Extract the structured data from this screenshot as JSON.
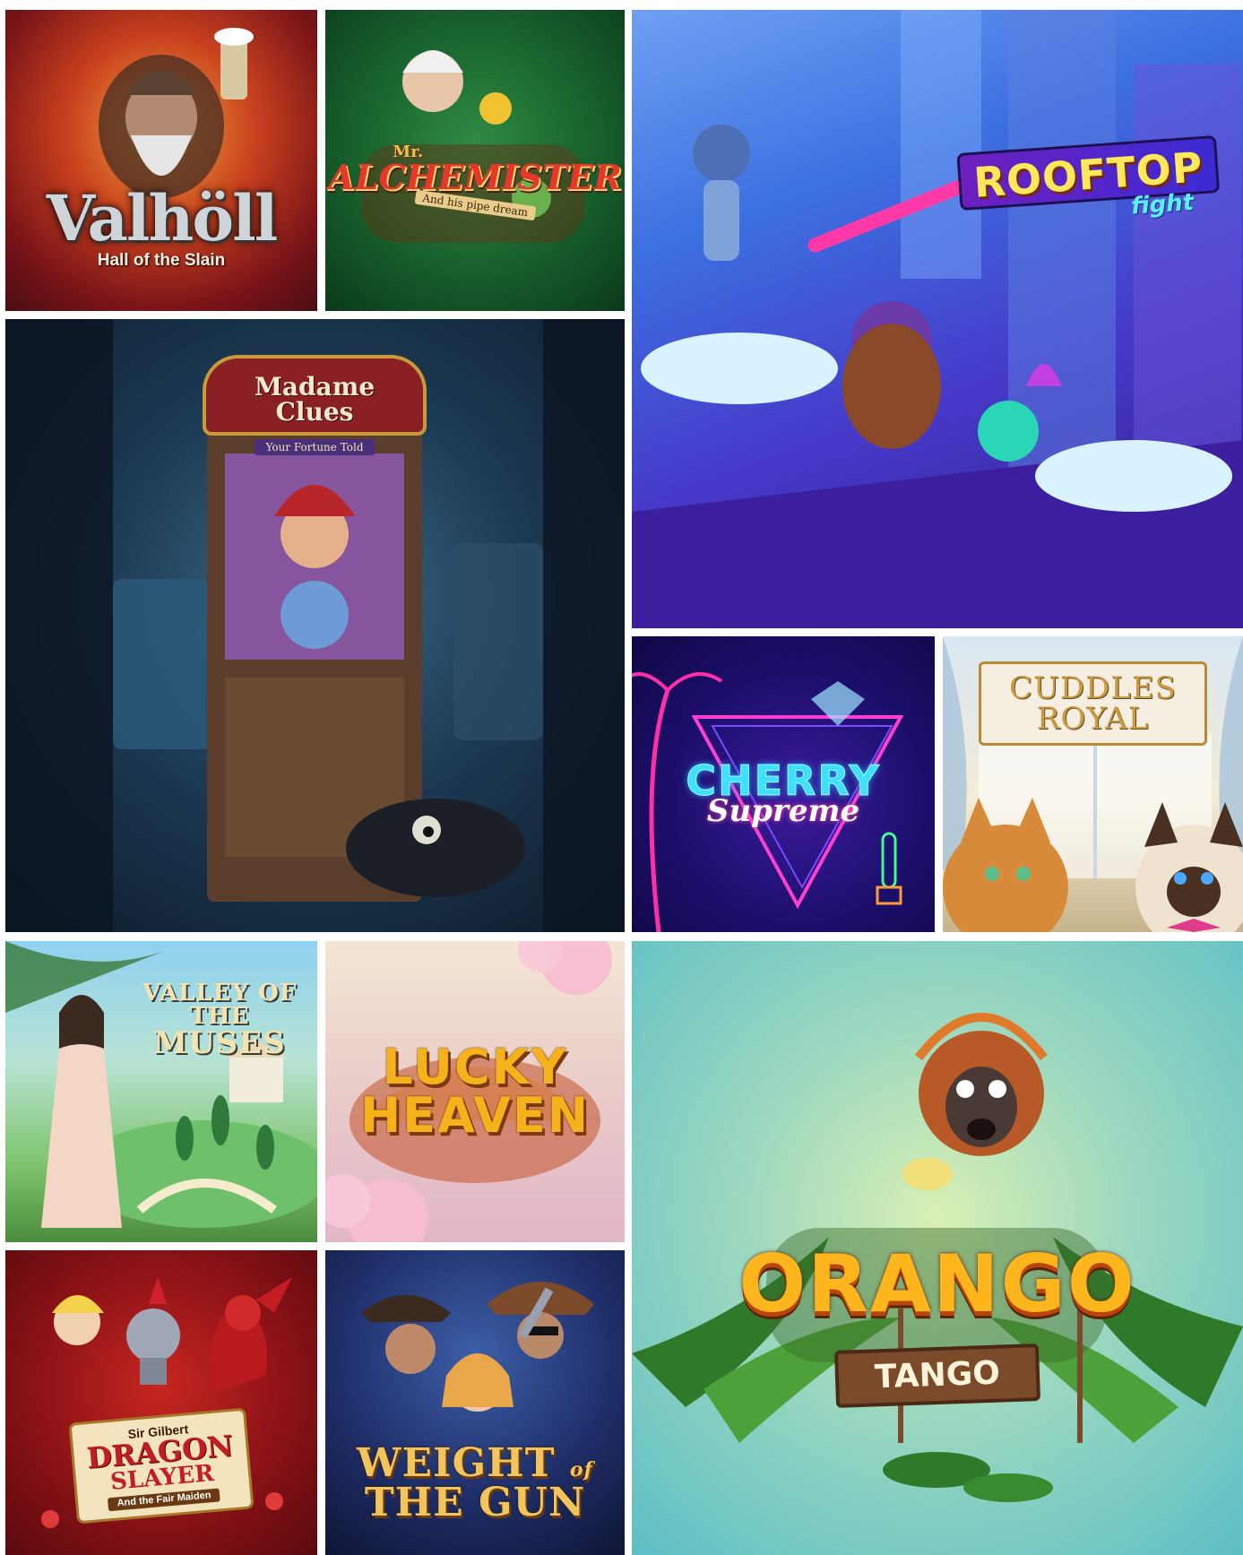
{
  "games": {
    "valholl": {
      "title": "Valhöll",
      "subtitle": "Hall of the Slain"
    },
    "alchemister": {
      "prefix": "Mr.",
      "title": "ALCHEMISTER",
      "subtitle": "And his pipe dream"
    },
    "rooftop": {
      "title": "ROOFTOP",
      "subtitle": "fight"
    },
    "madame": {
      "title": "Madame Clues",
      "subtitle": "Your Fortune Told"
    },
    "cherry": {
      "title": "CHERRY",
      "subtitle": "Supreme"
    },
    "cuddles": {
      "line1": "CUDDLES",
      "line2": "ROYAL"
    },
    "valley": {
      "line1": "VALLEY OF THE",
      "line2": "MUSES"
    },
    "lucky": {
      "line1": "LUCKY",
      "line2": "HEAVEN"
    },
    "orango": {
      "title": "ORANGO",
      "subtitle": "TANGO"
    },
    "dragon": {
      "prefix": "Sir Gilbert",
      "line1": "DRAGON",
      "line2": "SLAYER",
      "subtitle": "And the Fair Maiden"
    },
    "weight": {
      "line1": "WEIGHT",
      "line1_small": "of",
      "line2": "THE GUN"
    }
  }
}
